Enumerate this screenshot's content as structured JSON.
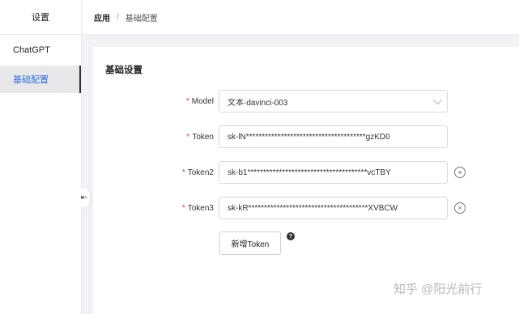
{
  "sidebar": {
    "title": "设置",
    "items": [
      {
        "label": "ChatGPT",
        "active": false
      },
      {
        "label": "基础配置",
        "active": true
      }
    ]
  },
  "header": {
    "breadcrumb_root": "应用",
    "breadcrumb_separator": "/",
    "breadcrumb_current": "基础配置"
  },
  "main": {
    "section_title": "基础设置",
    "form": {
      "model": {
        "required_mark": "*",
        "label": "Model",
        "value": "文本-davinci-003"
      },
      "token": {
        "required_mark": "*",
        "label": "Token",
        "value": "sk-lN**************************************gzKD0"
      },
      "token2": {
        "required_mark": "*",
        "label": "Token2",
        "value": "sk-b1**************************************vcTBY"
      },
      "token3": {
        "required_mark": "*",
        "label": "Token3",
        "value": "sk-kR**************************************XVBCW"
      }
    },
    "add_token_label": "新增Token",
    "help_glyph": "?",
    "remove_glyph": "×",
    "collapse_glyph": "⇤"
  },
  "watermark": "知乎 @阳光前行",
  "colors": {
    "active_text": "#2f6fde",
    "required": "#e03b3b",
    "page_bg": "#f0f2f5"
  },
  "icons": [
    "chevron-down-icon",
    "close-circle-icon",
    "question-circle-icon",
    "collapse-sidebar-icon"
  ]
}
